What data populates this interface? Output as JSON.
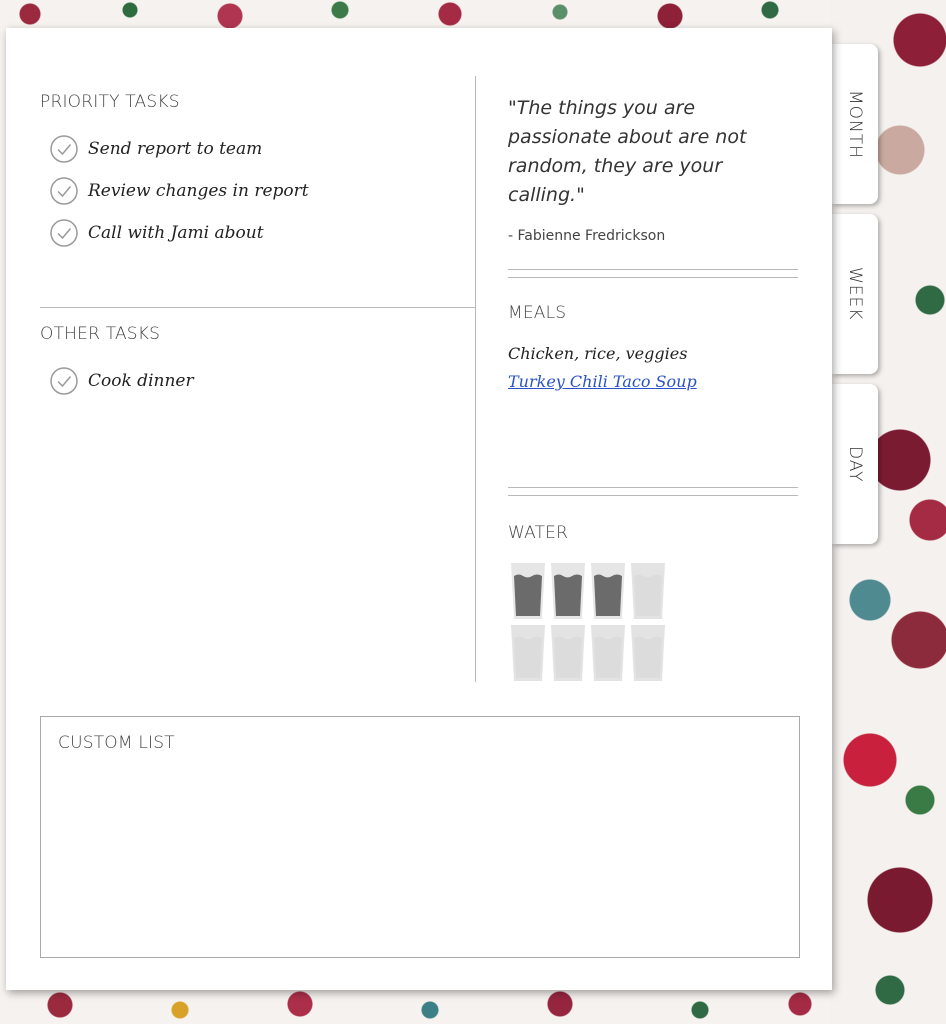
{
  "priority": {
    "title": "PRIORITY TASKS",
    "tasks": [
      "Send report to team",
      "Review changes in report",
      "Call with Jami about"
    ]
  },
  "other": {
    "title": "OTHER TASKS",
    "tasks": [
      "Cook dinner"
    ]
  },
  "quote": {
    "text": "\"The things you are passionate about are not random, they are your calling.\"",
    "author": "- Fabienne Fredrickson"
  },
  "meals": {
    "title": "MEALS",
    "items": [
      "Chicken, rice, veggies"
    ],
    "link": "Turkey Chili Taco Soup"
  },
  "water": {
    "title": "WATER",
    "total": 8,
    "filled": 3
  },
  "custom_list": {
    "title": "CUSTOM LIST"
  },
  "tabs": [
    "MONTH",
    "WEEK",
    "DAY"
  ],
  "colors": {
    "glass_filled": "#6b6b6b",
    "glass_empty": "#dcdcdc",
    "link": "#2a52c9"
  }
}
